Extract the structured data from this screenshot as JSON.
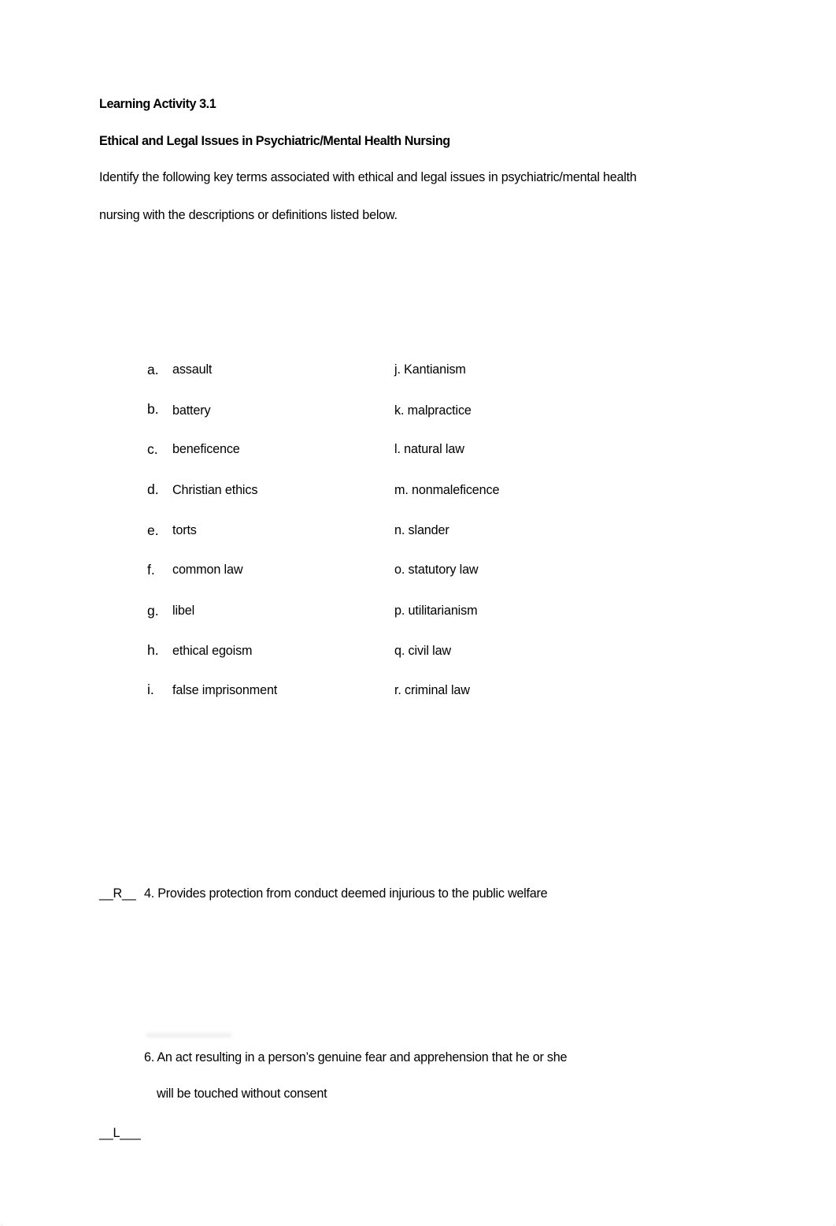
{
  "document": {
    "title": "Learning Activity 3.1",
    "subtitle": "Ethical and Legal Issues in Psychiatric/Mental Health Nursing",
    "instructions": {
      "line1": "Identify the following key terms associated with ethical and legal issues in psychiatric/mental health",
      "line2": "nursing with the descriptions or definitions listed below."
    },
    "terms_left": [
      {
        "marker": "a.",
        "term": "assault"
      },
      {
        "marker": "b.",
        "term": "battery"
      },
      {
        "marker": "c.",
        "term": "beneficence"
      },
      {
        "marker": "d.",
        "term": "Christian ethics"
      },
      {
        "marker": "e.",
        "term": "torts"
      },
      {
        "marker": "f.",
        "term": "common law"
      },
      {
        "marker": "g.",
        "term": "libel"
      },
      {
        "marker": "h.",
        "term": "ethical egoism"
      },
      {
        "marker": "i.",
        "term": "false imprisonment"
      }
    ],
    "terms_right": [
      "j. Kantianism",
      "k. malpractice",
      "l. natural law",
      "m. nonmaleficence",
      "n. slander",
      "o. statutory law",
      "p. utilitarianism",
      "q. civil law",
      "r. criminal law"
    ],
    "questions": [
      {
        "answer_blank": "__R__",
        "text": "4. Provides protection from conduct deemed injurious to the public welfare"
      },
      {
        "answer_blank": "",
        "text_line1": "6. An act resulting in a person’s genuine fear and apprehension that he or she",
        "text_line2": "will be touched without consent"
      }
    ],
    "trailing_answer_blank": "__L___"
  }
}
